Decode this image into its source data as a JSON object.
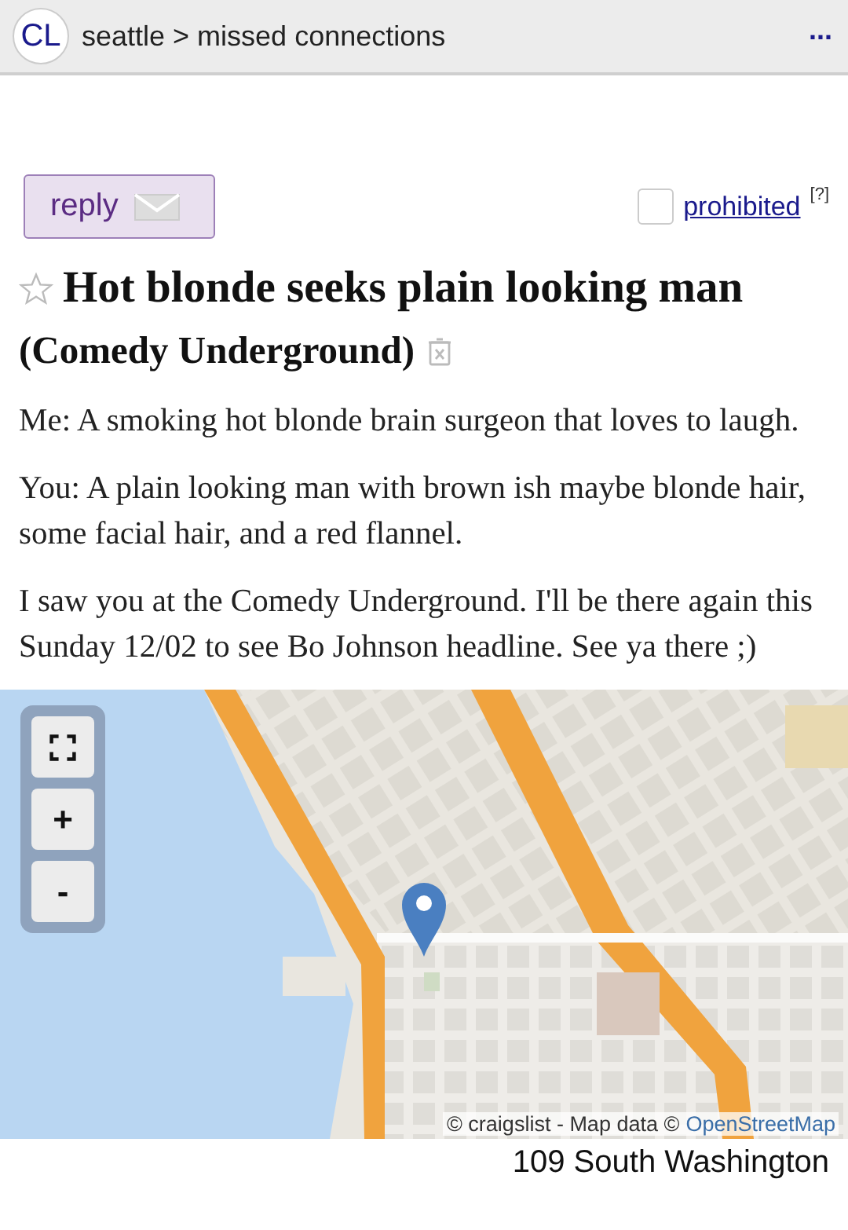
{
  "header": {
    "logo": "CL",
    "breadcrumb": "seattle > missed connections",
    "menu": "..."
  },
  "reply_button": {
    "label": "reply"
  },
  "prohibited": {
    "checked": false,
    "label": "prohibited",
    "help": "[?]"
  },
  "post": {
    "starred": false,
    "title": "Hot blonde seeks plain looking man",
    "location": "(Comedy Underground)",
    "paragraphs": [
      "Me: A smoking hot blonde brain surgeon that loves to laugh.",
      "You: A plain looking man with brown ish maybe blonde hair, some facial hair, and a red flannel.",
      "I saw you at the Comedy Underground. I'll be there again this Sunday 12/02 to see Bo Johnson headline. See ya there ;)"
    ]
  },
  "map": {
    "controls": [
      {
        "kind": "fullscreen"
      },
      {
        "kind": "zoom_in",
        "label": "+"
      },
      {
        "kind": "zoom_out",
        "label": "-"
      }
    ],
    "attribution": "© craigslist - Map data ©",
    "attribution_link": "OpenStreetMap"
  },
  "address": "109 South Washington"
}
